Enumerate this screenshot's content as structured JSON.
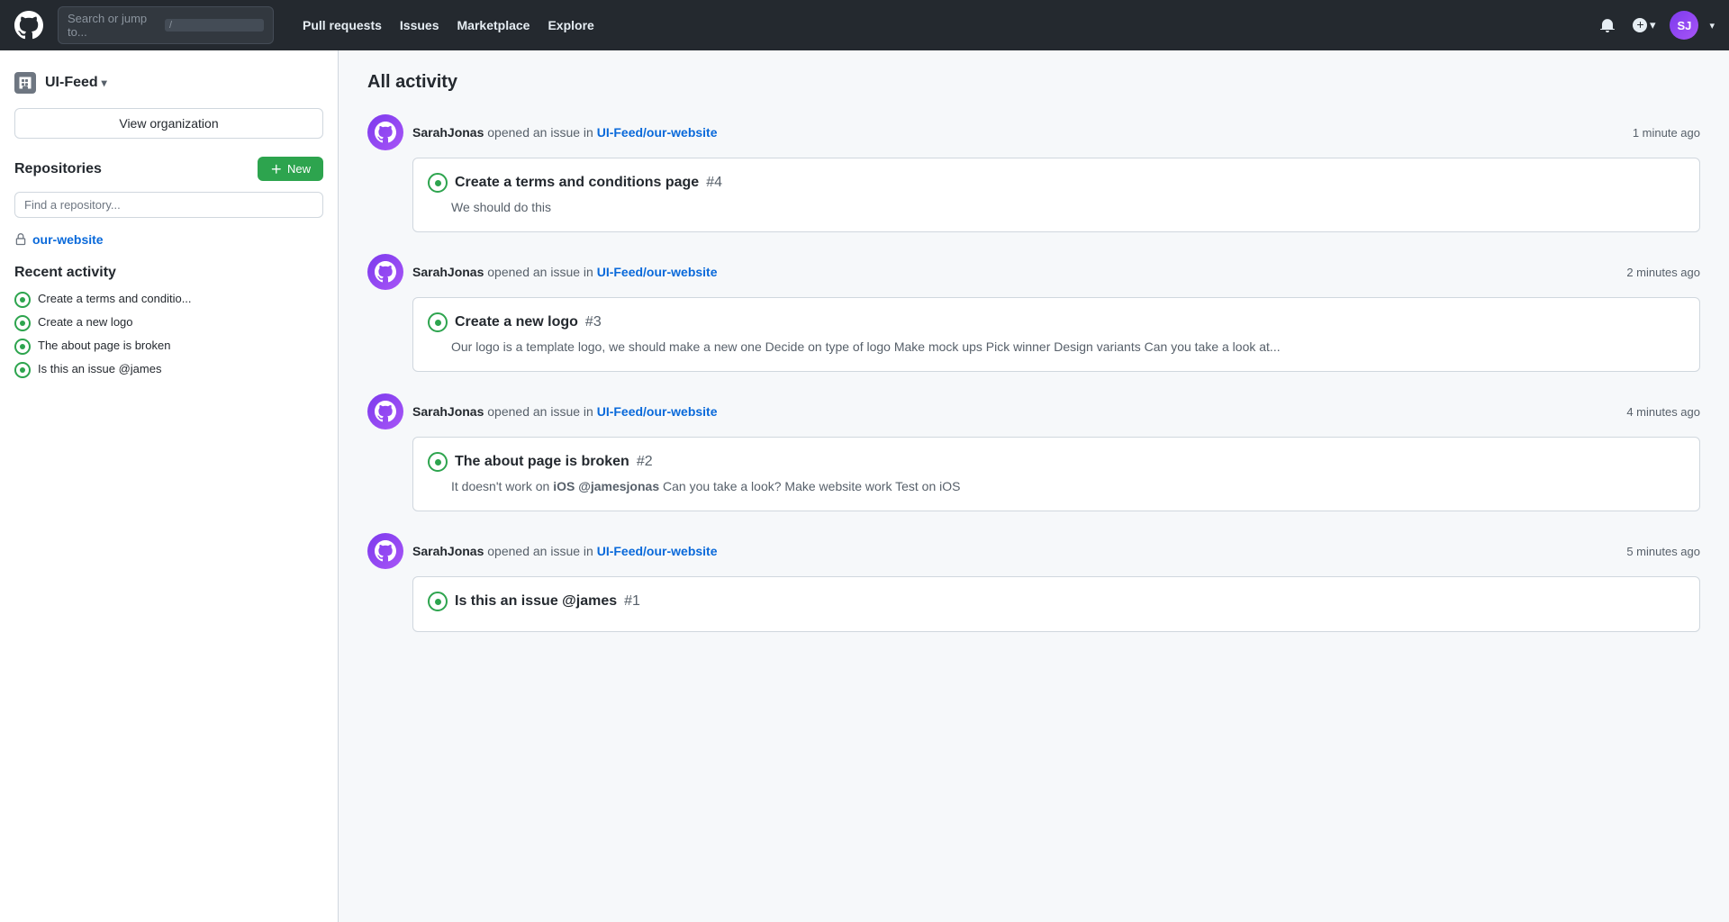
{
  "nav": {
    "search_placeholder": "Search or jump to...",
    "kbd": "/",
    "links": [
      "Pull requests",
      "Issues",
      "Marketplace",
      "Explore"
    ],
    "plus_label": "+",
    "avatar_initials": "SJ"
  },
  "sidebar": {
    "org_name": "UI-Feed",
    "view_org_label": "View organization",
    "repositories_label": "Repositories",
    "new_label": "New",
    "find_placeholder": "Find a repository...",
    "repo_name": "our-website",
    "recent_label": "Recent activity",
    "recent_items": [
      "Create a terms and conditio...",
      "Create a new logo",
      "The about page is broken",
      "Is this an issue @james"
    ]
  },
  "main": {
    "title": "All activity",
    "activities": [
      {
        "actor": "SarahJonas",
        "action": "opened an issue in",
        "repo": "UI-Feed/our-website",
        "time": "1 minute ago",
        "issue_title": "Create a terms and conditions page",
        "issue_number": "#4",
        "issue_body": "We should do this"
      },
      {
        "actor": "SarahJonas",
        "action": "opened an issue in",
        "repo": "UI-Feed/our-website",
        "time": "2 minutes ago",
        "issue_title": "Create a new logo",
        "issue_number": "#3",
        "issue_body": "Our logo is a template logo, we should make a new one Decide on type of logo Make mock ups Pick winner Design variants Can you take a look at..."
      },
      {
        "actor": "SarahJonas",
        "action": "opened an issue in",
        "repo": "UI-Feed/our-website",
        "time": "4 minutes ago",
        "issue_title": "The about page is broken",
        "issue_number": "#2",
        "issue_body": "It doesn't work on iOS @jamesjonas Can you take a look? Make website work Test on iOS"
      },
      {
        "actor": "SarahJonas",
        "action": "opened an issue in",
        "repo": "UI-Feed/our-website",
        "time": "5 minutes ago",
        "issue_title": "Is this an issue @james",
        "issue_number": "#1",
        "issue_body": ""
      }
    ]
  }
}
